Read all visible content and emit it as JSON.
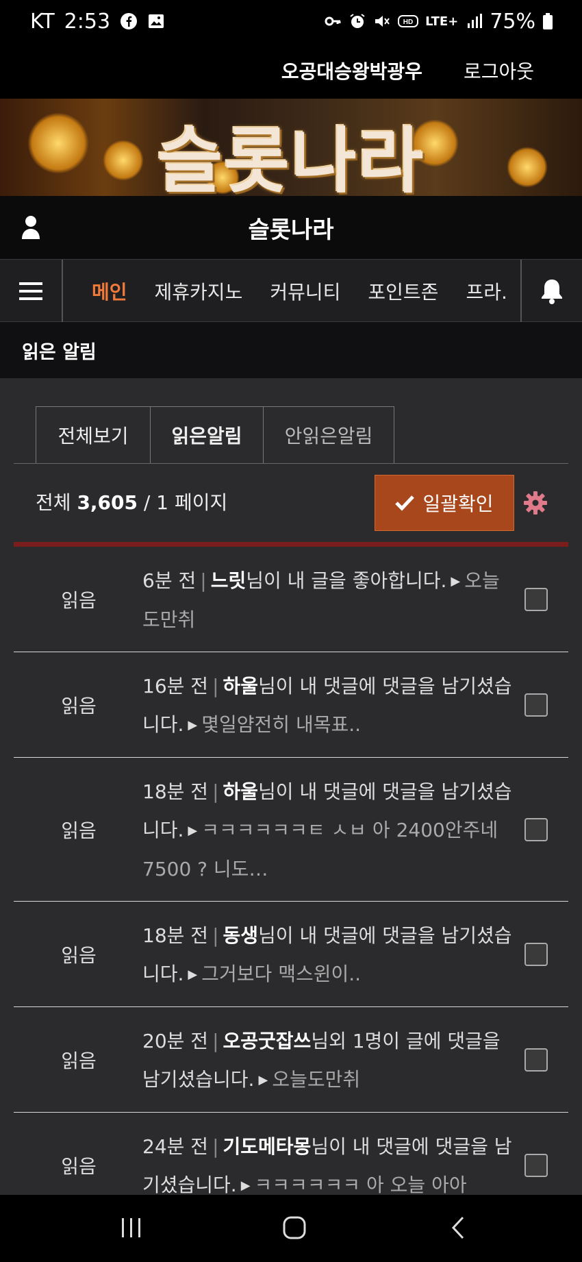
{
  "status_bar": {
    "carrier": "KT",
    "time": "2:53",
    "network": "LTE+",
    "battery": "75%",
    "icons": [
      "facebook-icon",
      "gallery-icon",
      "key-icon",
      "alarm-icon",
      "mute-icon",
      "hd-icon",
      "lte-icon",
      "signal-icon",
      "battery-icon"
    ]
  },
  "topbar": {
    "username": "오공대승왕박광우",
    "logout_label": "로그아웃"
  },
  "banner": {
    "title": "슬롯나라"
  },
  "sitebar": {
    "site_name": "슬롯나라"
  },
  "nav": {
    "items": [
      {
        "label": "메인",
        "active": true
      },
      {
        "label": "제휴카지노"
      },
      {
        "label": "커뮤니티"
      },
      {
        "label": "포인트존"
      },
      {
        "label": "프라."
      }
    ]
  },
  "page": {
    "title": "읽은 알림"
  },
  "tabs": [
    {
      "label": "전체보기"
    },
    {
      "label": "읽은알림",
      "active": true
    },
    {
      "label": "안읽은알림"
    }
  ],
  "summary": {
    "prefix": "전체",
    "total": "3,605",
    "slash": "/",
    "pages": "1 페이지"
  },
  "confirm_button": {
    "label": "일괄확인"
  },
  "colors": {
    "accent": "#f07a3a",
    "button_bg": "#a8471c",
    "divider": "#7a1d1d",
    "background": "#2b2b2d"
  },
  "notifications": [
    {
      "status": "읽음",
      "time": "6분 전",
      "nick": "느릿",
      "message": "님이 내 글을 좋아합니다.",
      "preview": "오늘도만취"
    },
    {
      "status": "읽음",
      "time": "16분 전",
      "nick": "하울",
      "message": "님이 내 댓글에 댓글을 남기셨습니다.",
      "preview": "몇일얌전히 내목표.."
    },
    {
      "status": "읽음",
      "time": "18분 전",
      "nick": "하울",
      "message": "님이 내 댓글에 댓글을 남기셨습니다.",
      "preview": "ㅋㅋㅋㅋㅋㅋㅌ ㅅㅂ 아 2400안주네 7500 ? 니도…"
    },
    {
      "status": "읽음",
      "time": "18분 전",
      "nick": "동생",
      "message": "님이 내 댓글에 댓글을 남기셨습니다.",
      "preview": "그거보다 맥스윈이.."
    },
    {
      "status": "읽음",
      "time": "20분 전",
      "nick": "오공굿잡쓰",
      "message": "님외 1명이 글에 댓글을 남기셨습니다.",
      "preview": "오늘도만취"
    },
    {
      "status": "읽음",
      "time": "24분 전",
      "nick": "기도메타몽",
      "message": "님이 내 댓글에 댓글을 남기셨습니다.",
      "preview": "ㅋㅋㅋㅋㅋㅋ 아 오늘 아아"
    }
  ]
}
